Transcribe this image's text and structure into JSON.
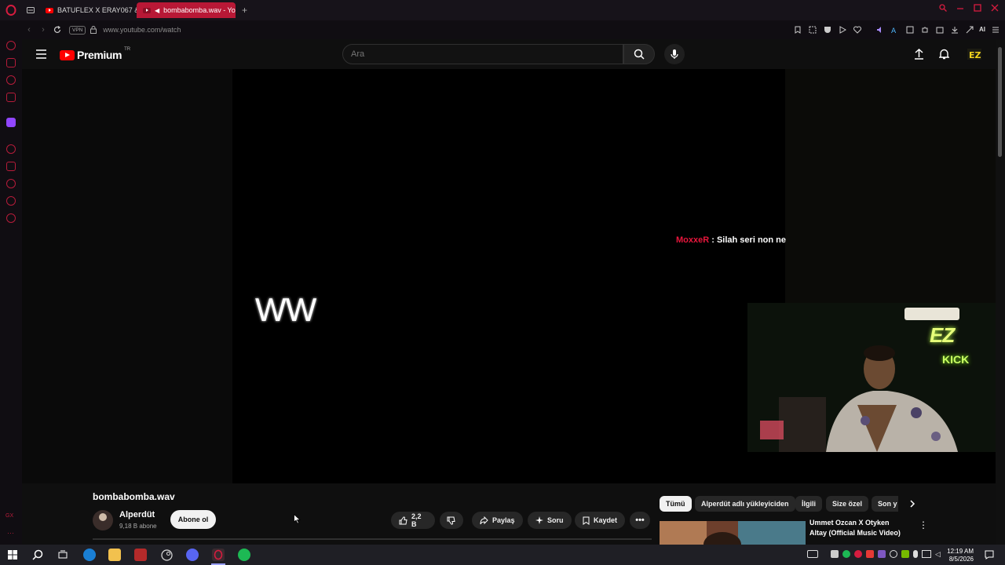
{
  "browser": {
    "tabs": [
      {
        "label": "BATUFLEX X ERAY067 & M",
        "active": false
      },
      {
        "label": "bombabomba.wav - Yo",
        "active": true
      }
    ],
    "new_tab": "+",
    "address": "www.youtube.com/watch",
    "vpn_badge": "VPN",
    "ai_label": "AI"
  },
  "youtube": {
    "logo_text": "Premium",
    "logo_sup": "TR",
    "search_placeholder": "Ara"
  },
  "video": {
    "overlay_text": "WW",
    "chat_user": "MoxxeR",
    "chat_message": ": Silah seri non ne",
    "webcam_sign_top": "EZ",
    "webcam_sign_bottom": "KICK",
    "title": "bombabomba.wav",
    "channel": "Alperdüt",
    "subscribers": "9,18 B abone",
    "subscribe_label": "Abone ol",
    "likes": "2,2 B",
    "share_label": "Paylaş",
    "ask_label": "Soru",
    "save_label": "Kaydet"
  },
  "recommendations": {
    "chips": [
      "Tümü",
      "Alperdüt adlı yükleyiciden",
      "İlgili",
      "Size özel",
      "Son y"
    ],
    "first": {
      "title": "Ummet Ozcan X Otyken   Altay (Official Music Video)"
    }
  },
  "taskbar": {
    "time": "12:19 AM",
    "date": "8/5/2026"
  },
  "colors": {
    "accent": "#b81836",
    "youtube_red": "#ff0000",
    "chat_user": "#e8163c"
  }
}
